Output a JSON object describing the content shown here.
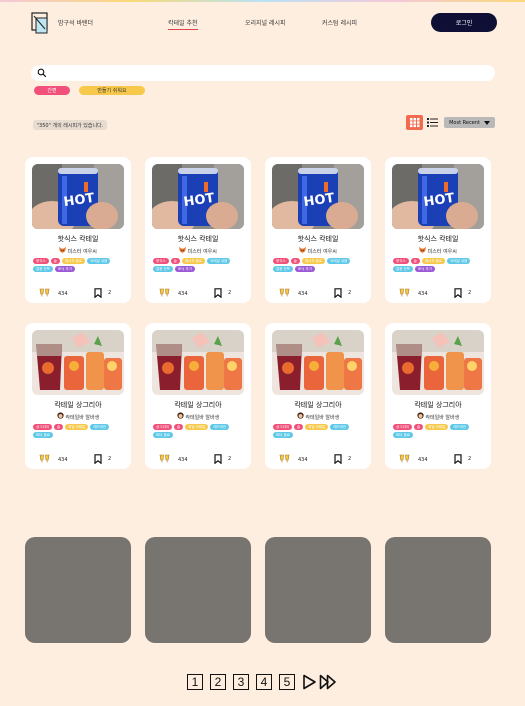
{
  "header": {
    "logo_text": "밤구석 바텐더",
    "nav": [
      "칵테일 추천",
      "오리지널 레시피",
      "커스텀 레시피"
    ],
    "login_label": "로그인"
  },
  "search": {
    "placeholder": ""
  },
  "filter_tags": [
    {
      "label": "간편",
      "color": "#f0507a"
    },
    {
      "label": "만들기 쉬워요",
      "color": "#f7c84a"
    }
  ],
  "result_count": "\"350\" 개의 레시피가 있습니다.",
  "sort": {
    "label": "Most Recent"
  },
  "tag_colors": [
    "#f0507a",
    "#f0507a",
    "#f7c84a",
    "#5ec8e8",
    "#5ec8e8",
    "#9b59d6"
  ],
  "cards": [
    {
      "title": "핫식스 칵테일",
      "author": "미스터 여우씨",
      "avatar": "fox",
      "likes": "434",
      "bookmarks": "2",
      "image": "can",
      "tags": [
        "핫식스",
        "술",
        "에너지 음료",
        "칵테일 쉬움",
        "얼음 잔뜩",
        "토닉 추가"
      ]
    },
    {
      "title": "핫식스 칵테일",
      "author": "미스터 여우씨",
      "avatar": "fox",
      "likes": "434",
      "bookmarks": "2",
      "image": "can",
      "tags": [
        "핫식스",
        "술",
        "에너지 음료",
        "칵테일 쉬움",
        "얼음 잔뜩",
        "토닉 추가"
      ]
    },
    {
      "title": "핫식스 칵테일",
      "author": "미스터 여우씨",
      "avatar": "fox",
      "likes": "434",
      "bookmarks": "2",
      "image": "can",
      "tags": [
        "핫식스",
        "술",
        "에너지 음료",
        "칵테일 쉬움",
        "얼음 잔뜩",
        "토닉 추가"
      ]
    },
    {
      "title": "핫식스 칵테일",
      "author": "미스터 여우씨",
      "avatar": "fox",
      "likes": "434",
      "bookmarks": "2",
      "image": "can",
      "tags": [
        "핫식스",
        "술",
        "에너지 음료",
        "칵테일 쉬움",
        "얼음 잔뜩",
        "토닉 추가"
      ]
    },
    {
      "title": "칵테일 상그리아",
      "author": "칵테일바 알바생",
      "avatar": "girl",
      "likes": "434",
      "bookmarks": "2",
      "image": "sangria",
      "tags": [
        "상그리아",
        "술",
        "과일 칵테일",
        "레드와인",
        "파티 음료"
      ]
    },
    {
      "title": "칵테일 상그리아",
      "author": "칵테일바 알바생",
      "avatar": "girl",
      "likes": "434",
      "bookmarks": "2",
      "image": "sangria",
      "tags": [
        "상그리아",
        "술",
        "과일 칵테일",
        "레드와인",
        "파티 음료"
      ]
    },
    {
      "title": "칵테일 상그리아",
      "author": "칵테일바 알바생",
      "avatar": "girl",
      "likes": "434",
      "bookmarks": "2",
      "image": "sangria",
      "tags": [
        "상그리아",
        "술",
        "과일 칵테일",
        "레드와인",
        "파티 음료"
      ]
    },
    {
      "title": "칵테일 상그리아",
      "author": "칵테일바 알바생",
      "avatar": "girl",
      "likes": "434",
      "bookmarks": "2",
      "image": "sangria",
      "tags": [
        "상그리아",
        "술",
        "과일 칵테일",
        "레드와인",
        "파티 음료"
      ]
    }
  ],
  "pagination": {
    "pages": [
      "1",
      "2",
      "3",
      "4",
      "5"
    ],
    "next_icon": "next-icon",
    "last_icon": "last-page-icon"
  }
}
